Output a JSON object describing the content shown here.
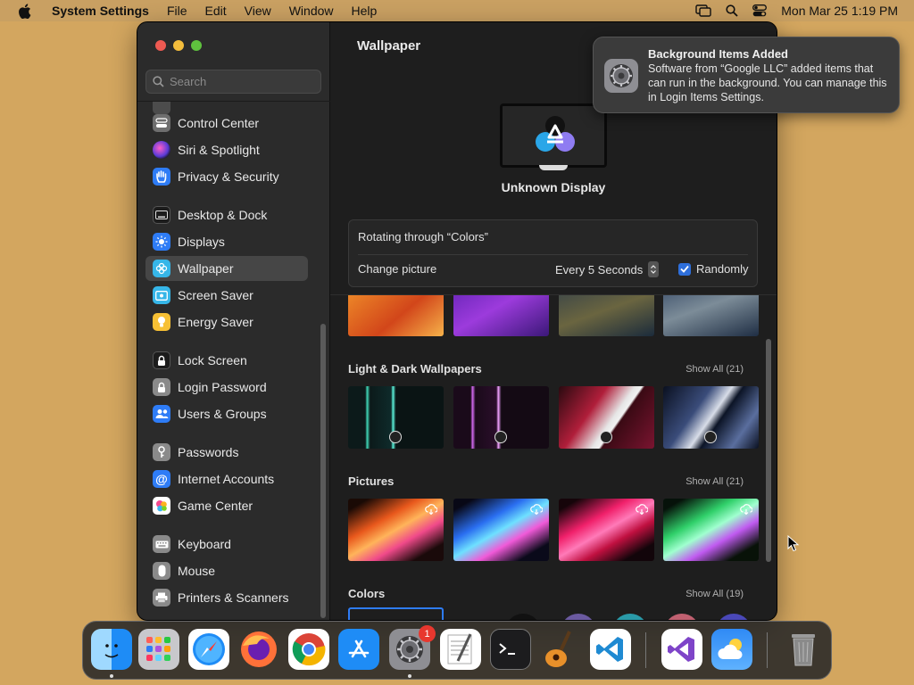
{
  "menubar": {
    "app": "System Settings",
    "menus": [
      "File",
      "Edit",
      "View",
      "Window",
      "Help"
    ],
    "clock": "Mon Mar 25  1:19 PM"
  },
  "search": {
    "placeholder": "Search"
  },
  "sidebar": {
    "items": [
      {
        "label": "Control Center",
        "icon": "control-center-icon",
        "color": "#6e6e6e"
      },
      {
        "label": "Siri & Spotlight",
        "icon": "siri-icon",
        "color": "#9b39c9"
      },
      {
        "label": "Privacy & Security",
        "icon": "hand-icon",
        "color": "#2e7cf6"
      },
      {
        "label": "Desktop & Dock",
        "icon": "dock-icon",
        "color": "#1c1c1c"
      },
      {
        "label": "Displays",
        "icon": "sun-icon",
        "color": "#2e7cf6"
      },
      {
        "label": "Wallpaper",
        "icon": "flower-icon",
        "color": "#36b6e8"
      },
      {
        "label": "Screen Saver",
        "icon": "screen-saver-icon",
        "color": "#36b6e8"
      },
      {
        "label": "Energy Saver",
        "icon": "bulb-icon",
        "color": "#f7c034"
      },
      {
        "label": "Lock Screen",
        "icon": "lock-icon",
        "color": "#1c1c1c"
      },
      {
        "label": "Login Password",
        "icon": "lock-key-icon",
        "color": "#8a8a8a"
      },
      {
        "label": "Users & Groups",
        "icon": "users-icon",
        "color": "#2e7cf6"
      },
      {
        "label": "Passwords",
        "icon": "key-icon",
        "color": "#8a8a8a"
      },
      {
        "label": "Internet Accounts",
        "icon": "at-icon",
        "color": "#2e7cf6"
      },
      {
        "label": "Game Center",
        "icon": "game-center-icon",
        "color": "#ffffff"
      },
      {
        "label": "Keyboard",
        "icon": "keyboard-icon",
        "color": "#8a8a8a"
      },
      {
        "label": "Mouse",
        "icon": "mouse-icon",
        "color": "#8a8a8a"
      },
      {
        "label": "Printers & Scanners",
        "icon": "printer-icon",
        "color": "#8a8a8a"
      }
    ],
    "selected": "Wallpaper"
  },
  "main": {
    "title": "Wallpaper",
    "display_name": "Unknown Display",
    "rotating_label": "Rotating through “Colors”",
    "change_picture_label": "Change picture",
    "interval_value": "Every 5 Seconds",
    "randomly_label": "Randomly",
    "randomly_checked": true,
    "sections": [
      {
        "title": "Light & Dark Wallpapers",
        "show_all": "Show All (21)"
      },
      {
        "title": "Pictures",
        "show_all": "Show All (21)"
      },
      {
        "title": "Colors",
        "show_all": "Show All (19)"
      }
    ]
  },
  "notification": {
    "title": "Background Items Added",
    "body": "Software from “Google LLC” added items that can run in the background. You can manage this in Login Items Settings."
  },
  "dock": {
    "apps": [
      "Finder",
      "Launchpad",
      "Safari",
      "Firefox",
      "Chrome",
      "App Store",
      "System Settings",
      "TextEdit",
      "Terminal",
      "GarageBand",
      "VS Code",
      "Visual Studio",
      "Weather",
      "Trash"
    ],
    "settings_badge": "1"
  }
}
